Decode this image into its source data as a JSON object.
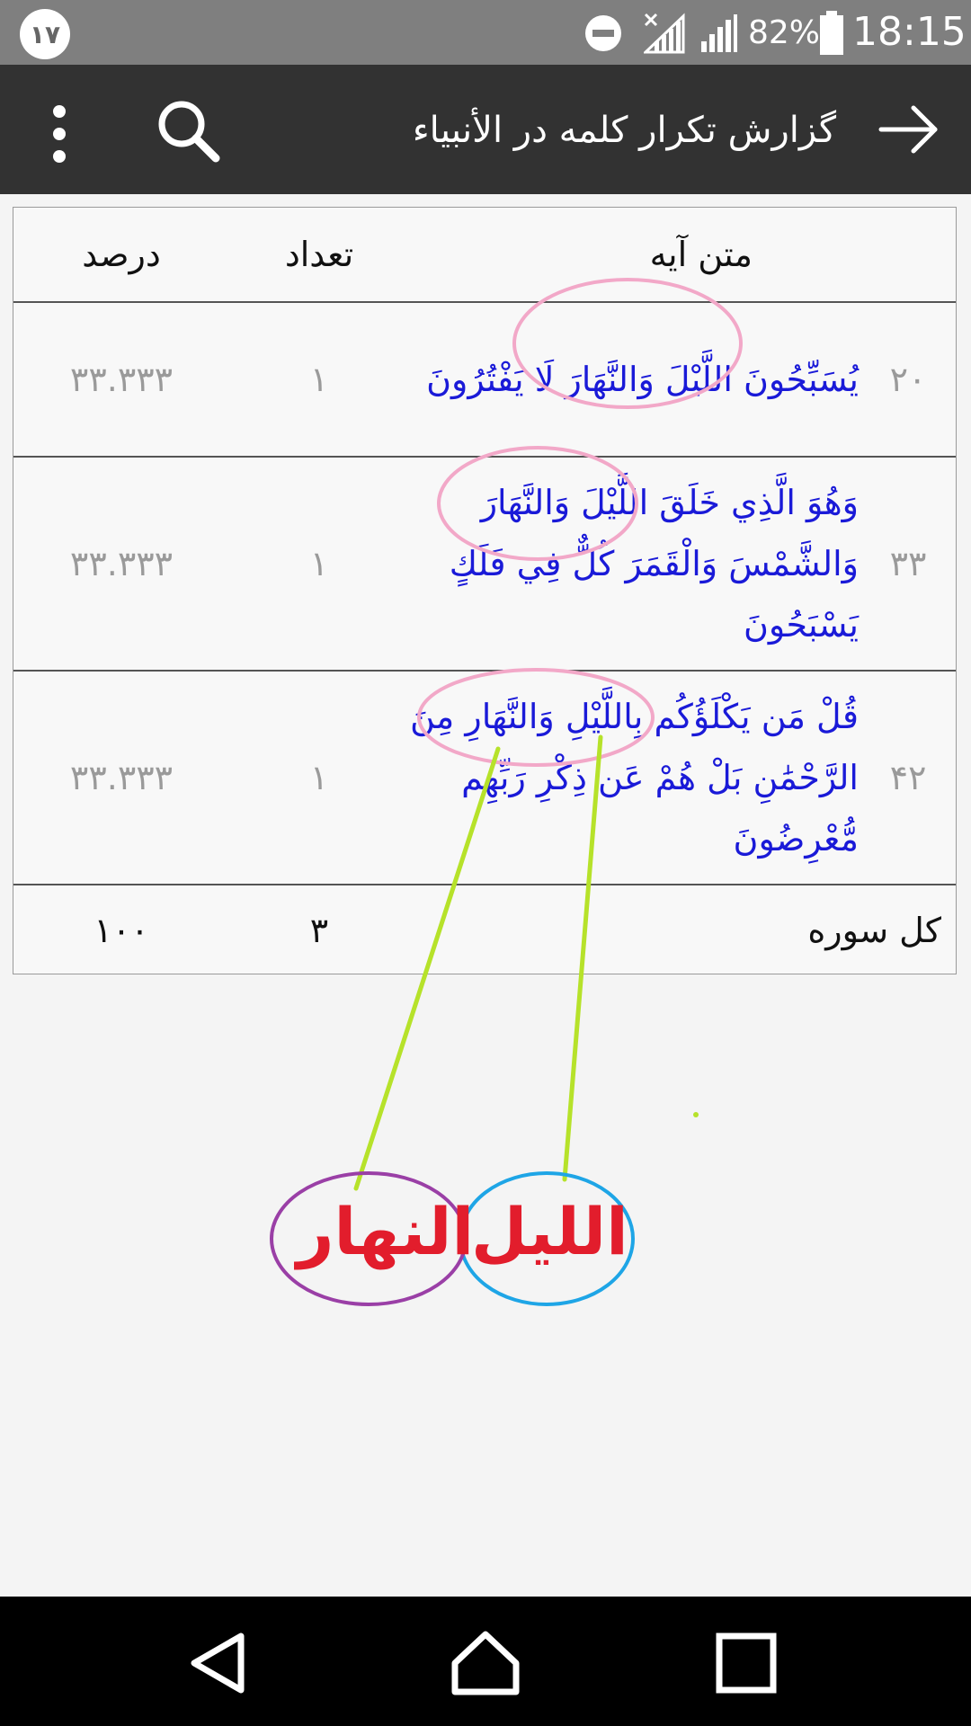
{
  "status": {
    "badge": "١٧",
    "battery": "82%",
    "time": "18:15"
  },
  "appbar": {
    "title": "گزارش تکرار کلمه در  الأنبیاء"
  },
  "table": {
    "headers": {
      "text": "متن آیه",
      "count": "تعداد",
      "percent": "درصد"
    },
    "rows": [
      {
        "num": "۲۰",
        "text": "يُسَبِّحُونَ اللَّيْلَ وَالنَّهَارَ لَا يَفْتُرُونَ",
        "count": "١",
        "percent": "۳۳.۳۳۳"
      },
      {
        "num": "۳۳",
        "text": "وَهُوَ الَّذِي خَلَقَ اللَّيْلَ وَالنَّهَارَ وَالشَّمْسَ وَالْقَمَرَ كُلٌّ فِي فَلَكٍ يَسْبَحُونَ",
        "count": "١",
        "percent": "۳۳.۳۳۳"
      },
      {
        "num": "۴۲",
        "text": "قُلْ مَن يَكْلَؤُكُم بِاللَّيْلِ وَالنَّهَارِ مِنَ الرَّحْمَٰنِ بَلْ هُمْ عَن ذِكْرِ رَبِّهِم مُّعْرِضُونَ",
        "count": "١",
        "percent": "۳۳.۳۳۳"
      }
    ],
    "total": {
      "label": "کل سوره",
      "count": "۳",
      "percent": "۱۰۰"
    }
  },
  "annotation": {
    "word_night": "الليل",
    "word_day": "النهار",
    "highlight_color": "#f2a8c8",
    "line_color": "#b6e22a",
    "night_circle_color": "#1ea5e6",
    "day_circle_color": "#9a3fa6",
    "label_color": "#e21d2c"
  },
  "icons": {
    "back": "arrow-right-icon",
    "search": "search-icon",
    "menu": "more-vert-icon",
    "nav_back": "triangle-back-icon",
    "nav_home": "home-icon",
    "nav_recents": "square-recents-icon"
  }
}
